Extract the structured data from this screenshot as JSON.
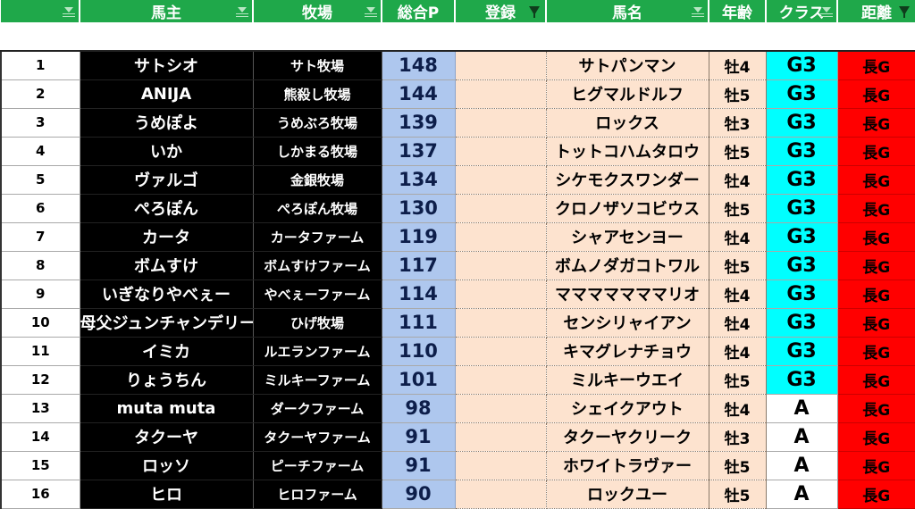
{
  "header": {
    "idx": "",
    "owner": "馬主",
    "farm": "牧場",
    "points": "総合P",
    "registered": "登録",
    "horse": "馬名",
    "age": "年齢",
    "class": "クラス",
    "distance": "距離"
  },
  "colors": {
    "header_green": "#1fa84a",
    "points_blue": "#aec7ee",
    "peach": "#fde3cf",
    "class_g3_cyan": "#00ffff",
    "distance_red": "#ff0000"
  },
  "rows": [
    {
      "idx": "1",
      "owner": "サトシオ",
      "farm": "サト牧場",
      "points": "148",
      "registered": "",
      "horse": "サトパンマン",
      "age": "牡4",
      "class": "G3",
      "distance": "長G"
    },
    {
      "idx": "2",
      "owner": "ANIJA",
      "farm": "熊殺し牧場",
      "points": "144",
      "registered": "",
      "horse": "ヒグマルドルフ",
      "age": "牡5",
      "class": "G3",
      "distance": "長G"
    },
    {
      "idx": "3",
      "owner": "うめぽよ",
      "farm": "うめぶろ牧場",
      "points": "139",
      "registered": "",
      "horse": "ロックス",
      "age": "牡3",
      "class": "G3",
      "distance": "長G"
    },
    {
      "idx": "4",
      "owner": "いか",
      "farm": "しかまる牧場",
      "points": "137",
      "registered": "",
      "horse": "トットコハムタロウ",
      "age": "牡5",
      "class": "G3",
      "distance": "長G"
    },
    {
      "idx": "5",
      "owner": "ヴァルゴ",
      "farm": "金銀牧場",
      "points": "134",
      "registered": "",
      "horse": "シケモクスワンダー",
      "age": "牡4",
      "class": "G3",
      "distance": "長G"
    },
    {
      "idx": "6",
      "owner": "ぺろぽん",
      "farm": "ぺろぽん牧場",
      "points": "130",
      "registered": "",
      "horse": "クロノザソコビウス",
      "age": "牡5",
      "class": "G3",
      "distance": "長G"
    },
    {
      "idx": "7",
      "owner": "カータ",
      "farm": "カータファーム",
      "points": "119",
      "registered": "",
      "horse": "シャアセンヨー",
      "age": "牡4",
      "class": "G3",
      "distance": "長G"
    },
    {
      "idx": "8",
      "owner": "ボムすけ",
      "farm": "ボムすけファーム",
      "points": "117",
      "registered": "",
      "horse": "ボムノダガコトワル",
      "age": "牡5",
      "class": "G3",
      "distance": "長G"
    },
    {
      "idx": "9",
      "owner": "いぎなりやべぇー",
      "farm": "やべぇーファーム",
      "points": "114",
      "registered": "",
      "horse": "マママママママリオ",
      "age": "牡4",
      "class": "G3",
      "distance": "長G"
    },
    {
      "idx": "10",
      "owner": "母父ジュンチャンデリーチ",
      "farm": "ひげ牧場",
      "points": "111",
      "registered": "",
      "horse": "センシリャイアン",
      "age": "牡4",
      "class": "G3",
      "distance": "長G"
    },
    {
      "idx": "11",
      "owner": "イミカ",
      "farm": "ルエランファーム",
      "points": "110",
      "registered": "",
      "horse": "キマグレナチョウ",
      "age": "牡4",
      "class": "G3",
      "distance": "長G"
    },
    {
      "idx": "12",
      "owner": "りょうちん",
      "farm": "ミルキーファーム",
      "points": "101",
      "registered": "",
      "horse": "ミルキーウエイ",
      "age": "牡5",
      "class": "G3",
      "distance": "長G"
    },
    {
      "idx": "13",
      "owner": "muta muta",
      "farm": "ダークファーム",
      "points": "98",
      "registered": "",
      "horse": "シェイクアウト",
      "age": "牡4",
      "class": "A",
      "distance": "長G"
    },
    {
      "idx": "14",
      "owner": "タクーヤ",
      "farm": "タクーヤファーム",
      "points": "91",
      "registered": "",
      "horse": "タクーヤクリーク",
      "age": "牡3",
      "class": "A",
      "distance": "長G"
    },
    {
      "idx": "15",
      "owner": "ロッソ",
      "farm": "ピーチファーム",
      "points": "91",
      "registered": "",
      "horse": "ホワイトラヴァー",
      "age": "牡5",
      "class": "A",
      "distance": "長G"
    },
    {
      "idx": "16",
      "owner": "ヒロ",
      "farm": "ヒロファーム",
      "points": "90",
      "registered": "",
      "horse": "ロックユー",
      "age": "牡5",
      "class": "A",
      "distance": "長G"
    }
  ]
}
